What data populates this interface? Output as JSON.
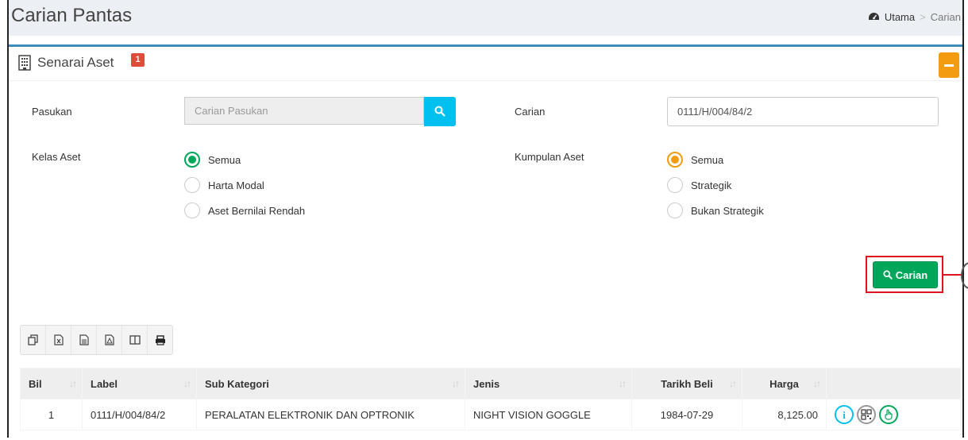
{
  "header": {
    "title": "Carian Pantas",
    "breadcrumb": {
      "home": "Utama",
      "separator": ">",
      "current": "Carian"
    }
  },
  "panel": {
    "title": "Senarai Aset",
    "badge": "1",
    "collapse_icon": "minus-icon"
  },
  "form": {
    "pasukan": {
      "label": "Pasukan",
      "placeholder": "Carian Pasukan",
      "value": ""
    },
    "carian": {
      "label": "Carian",
      "value": "0111/H/004/84/2"
    },
    "kelas_aset": {
      "label": "Kelas Aset",
      "options": [
        "Semua",
        "Harta Modal",
        "Aset Bernilai Rendah"
      ],
      "selected": "Semua"
    },
    "kumpulan_aset": {
      "label": "Kumpulan Aset",
      "options": [
        "Semua",
        "Strategik",
        "Bukan Strategik"
      ],
      "selected": "Semua"
    },
    "search_button": "Carian"
  },
  "toolbar": {
    "buttons": [
      "copy-icon",
      "excel-icon",
      "csv-icon",
      "pdf-icon",
      "columns-icon",
      "print-icon"
    ]
  },
  "table": {
    "columns": [
      "Bil",
      "Label",
      "Sub Kategori",
      "Jenis",
      "Tarikh Beli",
      "Harga",
      ""
    ],
    "rows": [
      {
        "bil": "1",
        "label": "0111/H/004/84/2",
        "sub_kategori": "PERALATAN ELEKTRONIK DAN OPTRONIK",
        "jenis": "NIGHT VISION GOGGLE",
        "tarikh_beli": "1984-07-29",
        "harga": "8,125.00",
        "actions": [
          "info-icon",
          "qr-code-icon",
          "pointer-icon"
        ]
      }
    ]
  },
  "colors": {
    "primary": "#3c8dbc",
    "success": "#00a65a",
    "info": "#00c0ef",
    "warning": "#f39c12",
    "danger": "#dd4b39",
    "highlight": "#e0141e"
  }
}
